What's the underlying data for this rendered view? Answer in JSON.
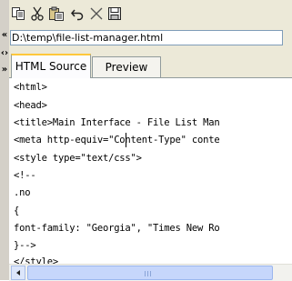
{
  "file_path": "D:\\temp\\file-list-manager.html",
  "tabs": [
    {
      "label": "HTML Source",
      "active": true
    },
    {
      "label": "Preview",
      "active": false
    }
  ],
  "toolbar_icons": [
    "copy-icon",
    "cut-icon",
    "paste-icon",
    "undo-icon",
    "delete-icon",
    "save-icon"
  ],
  "nav_arrows": {
    "collapse": "«",
    "swap": "‹›",
    "expand": "»"
  },
  "code_lines": [
    "<html>",
    "<head>",
    "<title>Main Interface - File List Man",
    "<meta http-equiv=\"Content-Type\" conte",
    "<style type=\"text/css\">",
    "<!--",
    ".no",
    "{",
    "font-family: \"Georgia\", \"Times New Ro",
    "}-->",
    "</style>"
  ],
  "colors": {
    "tab_highlight": "#ffc83c",
    "scrollbar": "#c6d6fb"
  }
}
